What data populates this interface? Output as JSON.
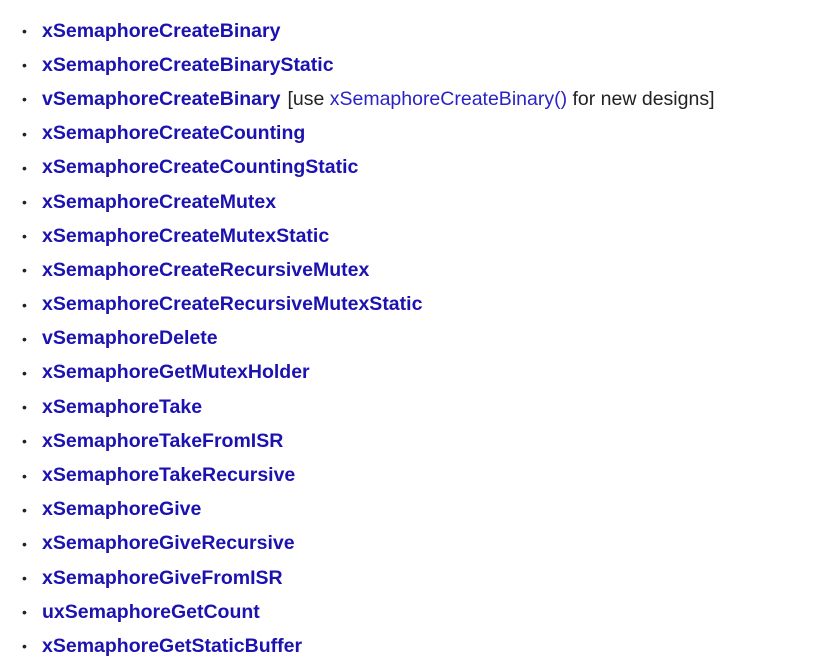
{
  "colors": {
    "link": "#1c12b0",
    "text": "#222222",
    "background": "#ffffff"
  },
  "bullet_glyph": "•",
  "items": [
    {
      "label": "xSemaphoreCreateBinary"
    },
    {
      "label": "xSemaphoreCreateBinaryStatic"
    },
    {
      "label": "vSemaphoreCreateBinary",
      "note": {
        "open": "[use ",
        "link": "xSemaphoreCreateBinary()",
        "close": " for new designs]"
      }
    },
    {
      "label": "xSemaphoreCreateCounting"
    },
    {
      "label": "xSemaphoreCreateCountingStatic"
    },
    {
      "label": "xSemaphoreCreateMutex"
    },
    {
      "label": "xSemaphoreCreateMutexStatic"
    },
    {
      "label": "xSemaphoreCreateRecursiveMutex"
    },
    {
      "label": "xSemaphoreCreateRecursiveMutexStatic"
    },
    {
      "label": "vSemaphoreDelete"
    },
    {
      "label": "xSemaphoreGetMutexHolder"
    },
    {
      "label": "xSemaphoreTake"
    },
    {
      "label": "xSemaphoreTakeFromISR"
    },
    {
      "label": "xSemaphoreTakeRecursive"
    },
    {
      "label": "xSemaphoreGive"
    },
    {
      "label": "xSemaphoreGiveRecursive"
    },
    {
      "label": "xSemaphoreGiveFromISR"
    },
    {
      "label": "uxSemaphoreGetCount"
    },
    {
      "label": "xSemaphoreGetStaticBuffer"
    }
  ]
}
